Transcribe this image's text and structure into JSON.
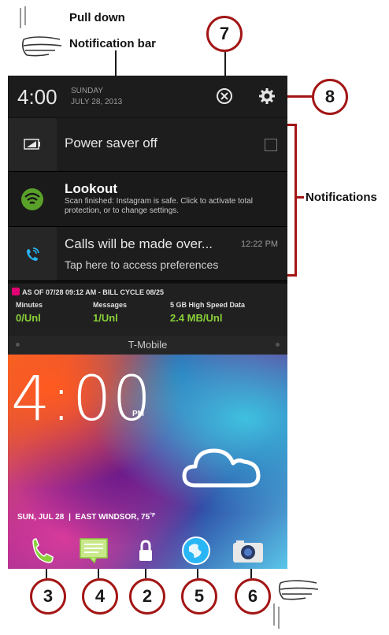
{
  "annotations": {
    "pull_down_line1": "Pull down",
    "pull_down_line2": "Notification bar",
    "notifications_label": "Notifications",
    "callouts": [
      "7",
      "8",
      "3",
      "4",
      "2",
      "5",
      "6"
    ]
  },
  "status_bar": {
    "time": "4:00",
    "day": "SUNDAY",
    "date": "JULY 28, 2013",
    "clear_icon": "close-circle-icon",
    "settings_icon": "gear-icon"
  },
  "notifications": [
    {
      "icon": "battery-icon",
      "title": "Power saver off",
      "checkbox": false
    },
    {
      "icon": "lookout-shield-icon",
      "title": "Lookout",
      "subtitle": "Scan finished: Instagram is safe. Click to activate total protection, or to change settings."
    },
    {
      "icon": "wifi-calling-icon",
      "title": "Calls will be made over...",
      "time": "12:22 PM",
      "subtitle": "Tap here to access preferences"
    }
  ],
  "carrier_widget": {
    "header": "AS OF  07/28 09:12 AM - BILL CYCLE 08/25",
    "columns": [
      {
        "label": "Minutes",
        "value": "0/Unl"
      },
      {
        "label": "Messages",
        "value": "1/Unl"
      },
      {
        "label": "5 GB High Speed Data",
        "value": "2.4 MB/Unl"
      }
    ]
  },
  "carrier_name": "T-Mobile",
  "lock_screen": {
    "time": "4:00",
    "ampm": "PM",
    "date": "SUN, JUL 28",
    "separator": "|",
    "location_temp": "EAST WINDSOR, 75",
    "temp_unit": "°F",
    "weather_icon": "cloud-icon"
  },
  "dock": [
    "phone-icon",
    "messages-icon",
    "lock-icon",
    "browser-icon",
    "camera-icon"
  ],
  "colors": {
    "callout": "#a31515",
    "accent_green": "#8bd13a",
    "wifi_blue": "#29b6f6"
  }
}
